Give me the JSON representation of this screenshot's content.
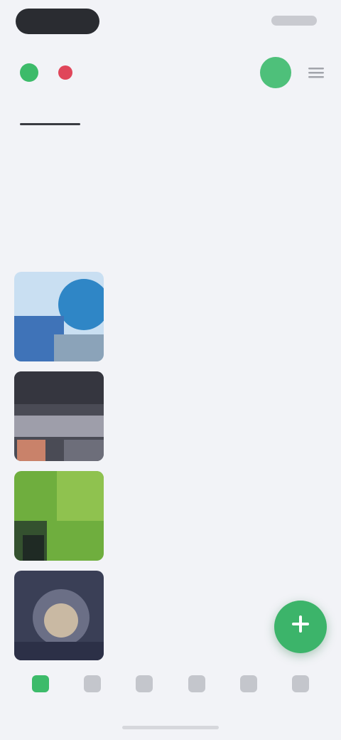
{
  "status_bar": {},
  "header": {
    "brand": "",
    "menu_icon": "menu-icon",
    "avatar_icon": "avatar-icon"
  },
  "tabs": [
    {
      "label": "",
      "active": true
    },
    {
      "label": "",
      "active": false
    },
    {
      "label": "",
      "active": false
    },
    {
      "label": "",
      "active": false
    }
  ],
  "page": {
    "title": "",
    "subtitle": ""
  },
  "section": {
    "title": ""
  },
  "articles": [
    {
      "category": "",
      "title": "",
      "meta": ""
    },
    {
      "category": "",
      "title": "",
      "meta": ""
    },
    {
      "category": "",
      "title": "",
      "meta": ""
    },
    {
      "category": "",
      "title": "",
      "meta": ""
    }
  ],
  "fab": {
    "icon": "plus-icon"
  },
  "bottom_nav": [
    {
      "label": "",
      "icon": "home-icon",
      "active": true
    },
    {
      "label": "",
      "icon": "explore-icon",
      "active": false
    },
    {
      "label": "",
      "icon": "bookmark-icon",
      "active": false
    },
    {
      "label": "",
      "icon": "chat-icon",
      "active": false
    },
    {
      "label": "",
      "icon": "bell-icon",
      "active": false
    },
    {
      "label": "",
      "icon": "profile-icon",
      "active": false
    }
  ],
  "colors": {
    "accent": "#3dbb6a",
    "alert": "#e0465a",
    "background": "#f2f3f7"
  }
}
